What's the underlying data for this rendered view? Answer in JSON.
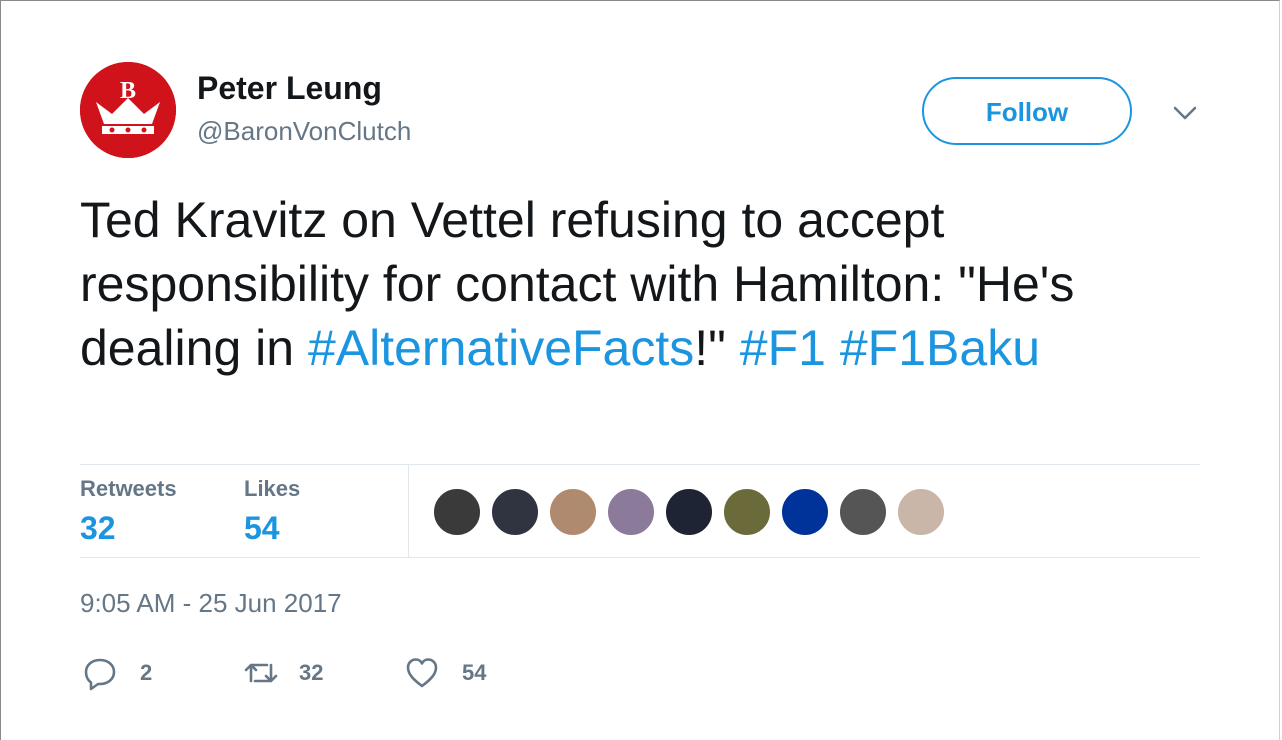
{
  "user": {
    "name": "Peter Leung",
    "handle": "@BaronVonClutch",
    "avatar_color": "#d0121b"
  },
  "follow_label": "Follow",
  "tweet": {
    "parts": [
      {
        "text": "Ted Kravitz on Vettel refusing to accept responsibility for contact with Hamilton: \"He's dealing in ",
        "hashtag": false
      },
      {
        "text": "#AlternativeFacts",
        "hashtag": true
      },
      {
        "text": "!\" ",
        "hashtag": false
      },
      {
        "text": "#F1",
        "hashtag": true
      },
      {
        "text": " ",
        "hashtag": false
      },
      {
        "text": "#F1Baku",
        "hashtag": true
      }
    ]
  },
  "stats": {
    "retweets_label": "Retweets",
    "retweets": "32",
    "likes_label": "Likes",
    "likes": "54"
  },
  "likers": [
    {
      "color": "#3a3a3a"
    },
    {
      "color": "#2f3440"
    },
    {
      "color": "#b08a6e"
    },
    {
      "color": "#8c7a9a"
    },
    {
      "color": "#1e2433"
    },
    {
      "color": "#6b6a3a"
    },
    {
      "color": "#003399"
    },
    {
      "color": "#555555"
    },
    {
      "color": "#c9b6a8"
    }
  ],
  "timestamp": "9:05 AM - 25 Jun 2017",
  "actions": {
    "replies": "2",
    "retweets": "32",
    "likes": "54"
  },
  "colors": {
    "accent": "#1b95e0",
    "muted": "#657786",
    "text": "#14171a"
  }
}
